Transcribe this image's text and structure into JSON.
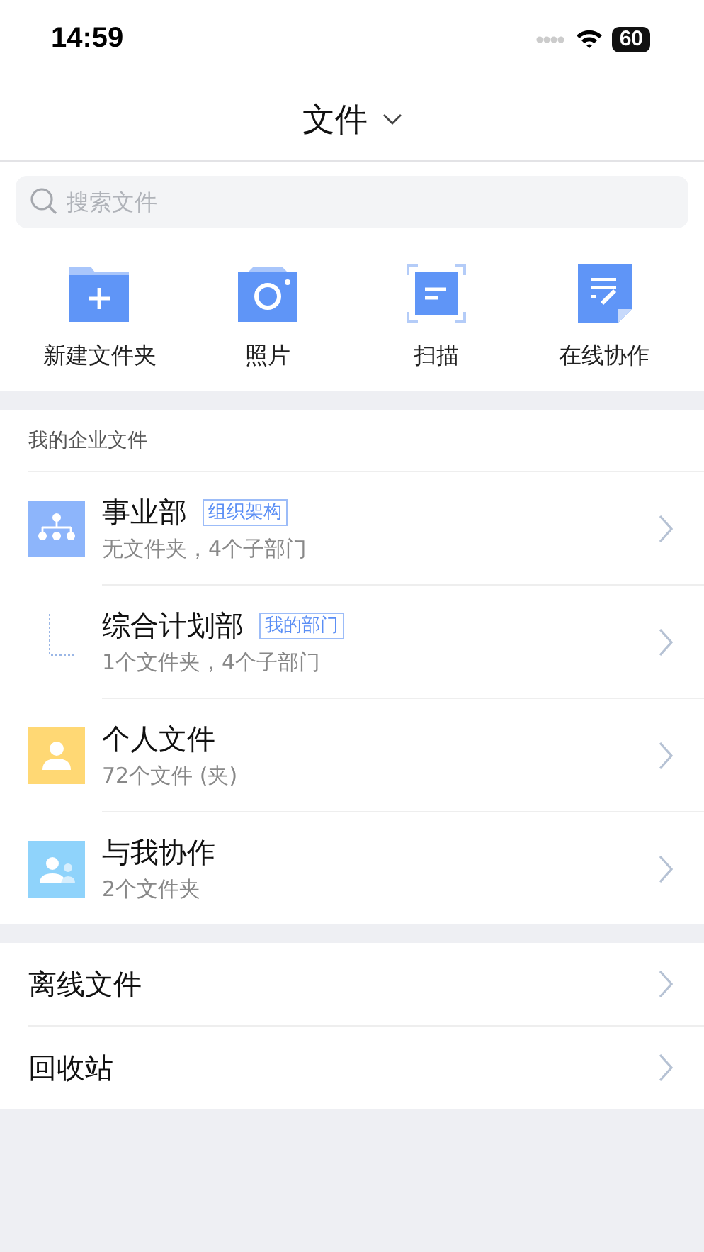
{
  "status_bar": {
    "time": "14:59",
    "battery": "60"
  },
  "header": {
    "title": "文件"
  },
  "search": {
    "placeholder": "搜索文件"
  },
  "actions": [
    {
      "kind": "new-folder",
      "label": "新建文件夹"
    },
    {
      "kind": "photo",
      "label": "照片"
    },
    {
      "kind": "scan",
      "label": "扫描"
    },
    {
      "kind": "collab",
      "label": "在线协作"
    }
  ],
  "enterprise": {
    "heading": "我的企业文件",
    "items": [
      {
        "kind": "org",
        "name": "事业部",
        "tag": "组织架构",
        "detail": "无文件夹，4个子部门"
      },
      {
        "kind": "dept",
        "name": "综合计划部",
        "tag": "我的部门",
        "detail": "1个文件夹，4个子部门"
      },
      {
        "kind": "personal",
        "name": "个人文件",
        "detail": "72个文件 (夹)"
      },
      {
        "kind": "shared",
        "name": "与我协作",
        "detail": "2个文件夹"
      }
    ]
  },
  "more": [
    {
      "label": "离线文件"
    },
    {
      "label": "回收站"
    }
  ]
}
